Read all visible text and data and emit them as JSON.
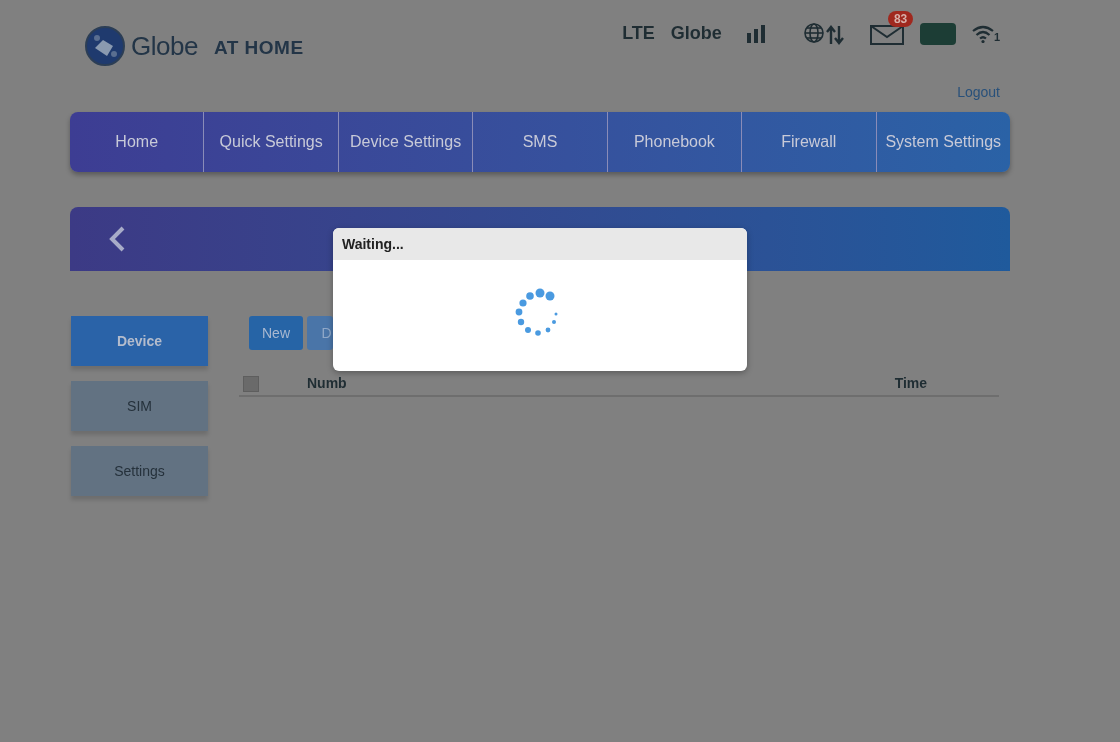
{
  "logo": {
    "brand": "Globe",
    "tagline": "AT HOME"
  },
  "status_bar": {
    "network": "LTE",
    "operator": "Globe",
    "unread_messages": "83",
    "wifi_clients": "1"
  },
  "logout": "Logout",
  "nav_tabs": [
    {
      "label": "Home",
      "selected": false
    },
    {
      "label": "Quick Settings",
      "selected": false
    },
    {
      "label": "Device Settings",
      "selected": false
    },
    {
      "label": "SMS",
      "selected": false
    },
    {
      "label": "Phonebook",
      "selected": false
    },
    {
      "label": "Firewall",
      "selected": false
    },
    {
      "label": "System Settings",
      "selected": false
    }
  ],
  "sidebar": {
    "items": [
      {
        "label": "Device",
        "selected": true
      },
      {
        "label": "SIM",
        "selected": false
      },
      {
        "label": "Settings",
        "selected": false
      }
    ]
  },
  "toolbar": {
    "buttons": [
      {
        "label": "New",
        "kind": "primary"
      },
      {
        "label": "D",
        "kind": "secondary"
      }
    ]
  },
  "table": {
    "select_all": {
      "checked": false
    },
    "columns": [
      "Numb",
      "Time"
    ]
  },
  "dialog": {
    "title": "Waiting..."
  }
}
